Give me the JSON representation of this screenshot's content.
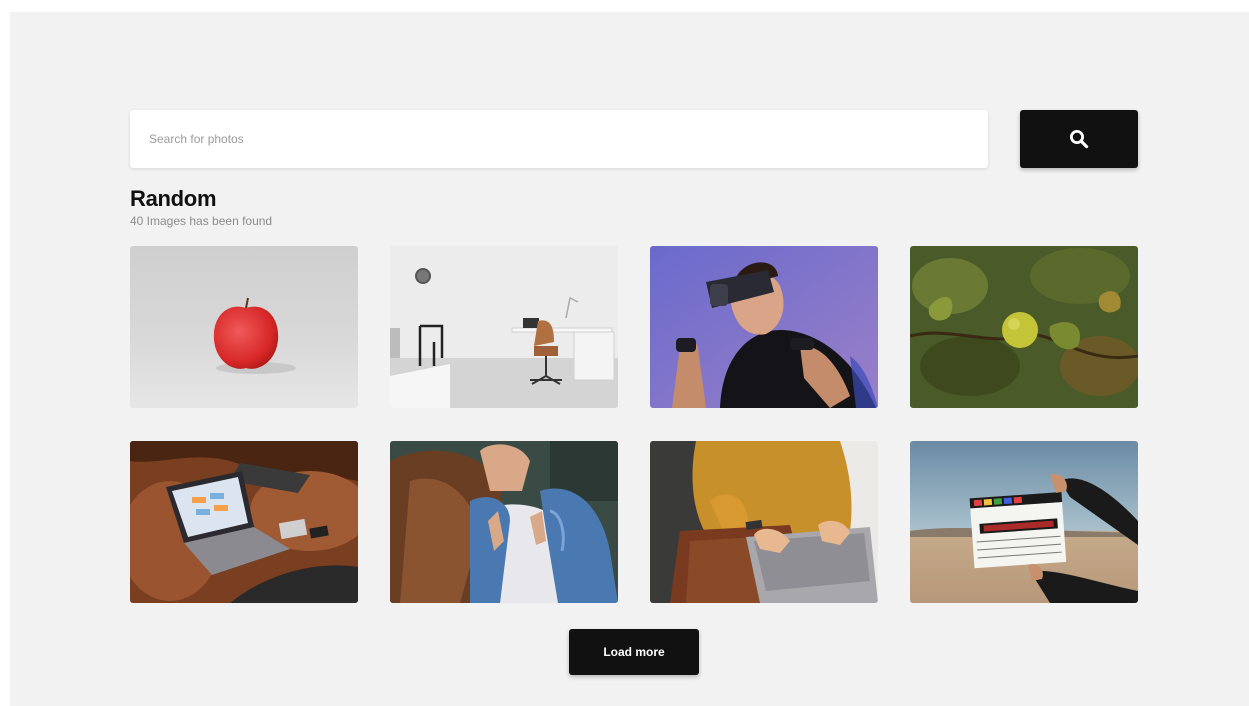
{
  "search": {
    "placeholder": "Search for photos",
    "value": "",
    "button_icon": "search-icon"
  },
  "gallery": {
    "title": "Random",
    "count_text": "40 Images has been found",
    "photos": [
      {
        "subject": "red-apple"
      },
      {
        "subject": "office-desk-chair"
      },
      {
        "subject": "vr-headset-man"
      },
      {
        "subject": "green-fruit-tree"
      },
      {
        "subject": "laptop-on-leather-couch"
      },
      {
        "subject": "woman-denim-jacket"
      },
      {
        "subject": "person-typing-laptop"
      },
      {
        "subject": "film-clapperboard"
      }
    ]
  },
  "load_more": {
    "label": "Load more"
  },
  "colors": {
    "background": "#f2f2f2",
    "button": "#111111",
    "button_text": "#ffffff",
    "input": "#ffffff"
  }
}
